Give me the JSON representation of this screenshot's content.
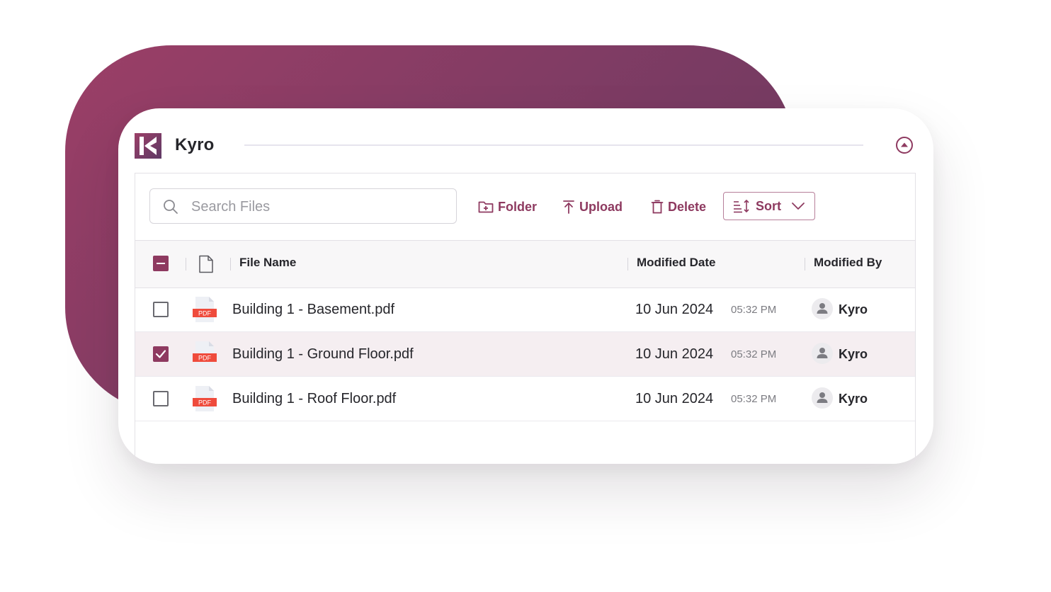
{
  "app": {
    "title": "Kyro"
  },
  "colors": {
    "accent": "#8e3a60",
    "backdrop_start": "#9b3f67",
    "backdrop_end": "#6d3a5e",
    "selected_row": "#f5eef1"
  },
  "toolbar": {
    "search_placeholder": "Search Files",
    "folder_label": "Folder",
    "upload_label": "Upload",
    "delete_label": "Delete",
    "sort_label": "Sort"
  },
  "table": {
    "columns": {
      "file_name": "File Name",
      "modified_date": "Modified Date",
      "modified_by": "Modified By"
    },
    "rows": [
      {
        "checked": false,
        "icon": "pdf-icon",
        "name": "Building 1 - Basement.pdf",
        "date": "10 Jun 2024",
        "time": "05:32 PM",
        "by": "Kyro"
      },
      {
        "checked": true,
        "icon": "pdf-icon",
        "name": "Building 1 - Ground Floor.pdf",
        "date": "10 Jun 2024",
        "time": "05:32 PM",
        "by": "Kyro"
      },
      {
        "checked": false,
        "icon": "pdf-icon",
        "name": "Building 1 - Roof Floor.pdf",
        "date": "10 Jun 2024",
        "time": "05:32 PM",
        "by": "Kyro"
      }
    ],
    "pdf_badge": "PDF"
  }
}
